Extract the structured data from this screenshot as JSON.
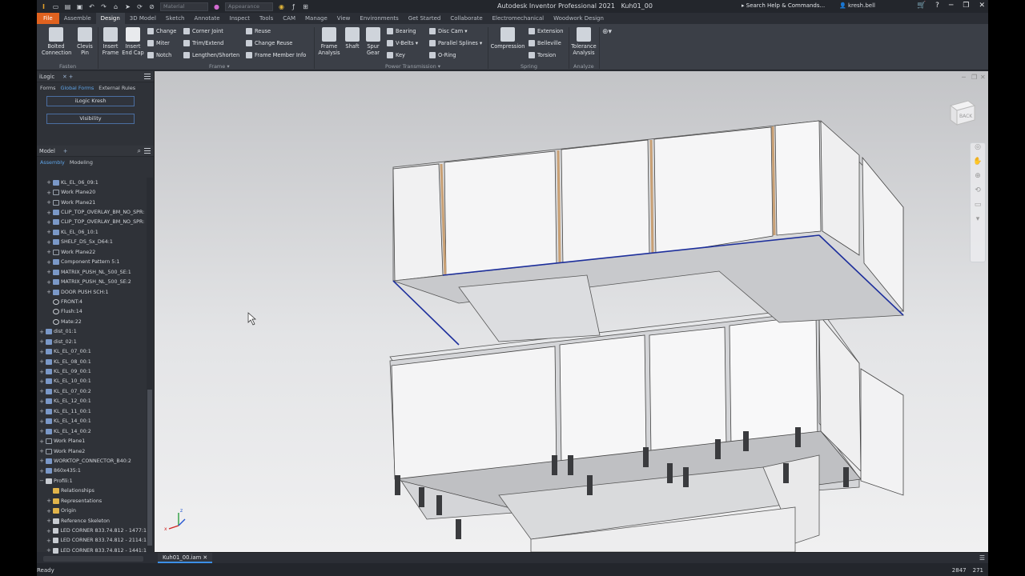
{
  "window": {
    "title": "Autodesk Inventor Professional 2021",
    "document": "Kuh01_00",
    "search_placeholder": "Search Help & Commands...",
    "user": "kresh.bell"
  },
  "qat": {
    "material": "Material",
    "appearance": "Appearance"
  },
  "tabs": [
    "File",
    "Assemble",
    "Design",
    "3D Model",
    "Sketch",
    "Annotate",
    "Inspect",
    "Tools",
    "CAM",
    "Manage",
    "View",
    "Environments",
    "Get Started",
    "Collaborate",
    "Electromechanical",
    "Woodwork Design"
  ],
  "active_tab": "Design",
  "ribbon": {
    "bolted_connection": "Bolted\nConnection",
    "clevis_pin": "Clevis\nPin",
    "fasten_label": "Fasten",
    "insert_frame": "Insert\nFrame",
    "insert_end_cap": "Insert\nEnd Cap",
    "change": "Change",
    "miter": "Miter",
    "notch": "Notch",
    "corner_joint": "Corner Joint",
    "trim_extend": "Trim/Extend",
    "lengthen_shorten": "Lengthen/Shorten",
    "reuse": "Reuse",
    "change_reuse": "Change Reuse",
    "frame_member_info": "Frame Member Info",
    "frame_label": "Frame ▾",
    "frame_analysis": "Frame\nAnalysis",
    "shaft": "Shaft",
    "spur_gear": "Spur\nGear",
    "bearing": "Bearing",
    "v_belts": "V-Belts ▾",
    "key": "Key",
    "disc_cam": "Disc Cam ▾",
    "parallel_splines": "Parallel Splines ▾",
    "o_ring": "O-Ring",
    "power_label": "Power Transmission ▾",
    "compression": "Compression",
    "extension": "Extension",
    "belleville": "Belleville",
    "torsion": "Torsion",
    "spring_label": "Spring",
    "tolerance_analysis": "Tolerance\nAnalysis",
    "analyze_label": "Analyze"
  },
  "logic_panel": {
    "title": "iLogic",
    "subtabs": [
      "Forms",
      "Global Forms",
      "External Rules"
    ],
    "buttons": [
      "iLogic Kresh",
      "Visibility"
    ]
  },
  "model_panel": {
    "title": "Model",
    "subtabs": [
      "Assembly",
      "Modeling"
    ],
    "items": [
      {
        "label": "KL_EL_06_09:1",
        "indent": 1,
        "exp": "+",
        "icon": "part"
      },
      {
        "label": "Work Plane20",
        "indent": 1,
        "exp": "+",
        "icon": "plane"
      },
      {
        "label": "Work Plane21",
        "indent": 1,
        "exp": "+",
        "icon": "plane"
      },
      {
        "label": "CLIP_TOP_OVERLAY_BM_NO_SPR:",
        "indent": 1,
        "exp": "+",
        "icon": "part"
      },
      {
        "label": "CLIP_TOP_OVERLAY_BM_NO_SPR:",
        "indent": 1,
        "exp": "+",
        "icon": "part"
      },
      {
        "label": "KL_EL_06_10:1",
        "indent": 1,
        "exp": "+",
        "icon": "part"
      },
      {
        "label": "SHELF_DS_Sx_D64:1",
        "indent": 1,
        "exp": "+",
        "icon": "part"
      },
      {
        "label": "Work Plane22",
        "indent": 1,
        "exp": "+",
        "icon": "plane"
      },
      {
        "label": "Component Pattern 5:1",
        "indent": 1,
        "exp": "+",
        "icon": "part"
      },
      {
        "label": "MATRIX_PUSH_NL_500_SE:1",
        "indent": 1,
        "exp": "+",
        "icon": "part"
      },
      {
        "label": "MATRIX_PUSH_NL_500_SE:2",
        "indent": 1,
        "exp": "+",
        "icon": "part"
      },
      {
        "label": "DOOR PUSH SCH:1",
        "indent": 1,
        "exp": "+",
        "icon": "part"
      },
      {
        "label": "FRONT:4",
        "indent": 1,
        "exp": "",
        "icon": "con"
      },
      {
        "label": "Flush:14",
        "indent": 1,
        "exp": "",
        "icon": "con"
      },
      {
        "label": "Mate:22",
        "indent": 1,
        "exp": "",
        "icon": "con"
      },
      {
        "label": "dist_01:1",
        "indent": 0,
        "exp": "+",
        "icon": "part"
      },
      {
        "label": "dist_02:1",
        "indent": 0,
        "exp": "+",
        "icon": "part"
      },
      {
        "label": "KL_EL_07_00:1",
        "indent": 0,
        "exp": "+",
        "icon": "part"
      },
      {
        "label": "KL_EL_08_00:1",
        "indent": 0,
        "exp": "+",
        "icon": "part"
      },
      {
        "label": "KL_EL_09_00:1",
        "indent": 0,
        "exp": "+",
        "icon": "part"
      },
      {
        "label": "KL_EL_10_00:1",
        "indent": 0,
        "exp": "+",
        "icon": "part"
      },
      {
        "label": "KL_EL_07_00:2",
        "indent": 0,
        "exp": "+",
        "icon": "part"
      },
      {
        "label": "KL_EL_12_00:1",
        "indent": 0,
        "exp": "+",
        "icon": "part"
      },
      {
        "label": "KL_EL_11_00:1",
        "indent": 0,
        "exp": "+",
        "icon": "part"
      },
      {
        "label": "KL_EL_14_00:1",
        "indent": 0,
        "exp": "+",
        "icon": "part"
      },
      {
        "label": "KL_EL_14_00:2",
        "indent": 0,
        "exp": "+",
        "icon": "part"
      },
      {
        "label": "Work Plane1",
        "indent": 0,
        "exp": "+",
        "icon": "plane"
      },
      {
        "label": "Work Plane2",
        "indent": 0,
        "exp": "+",
        "icon": "plane"
      },
      {
        "label": "WORKTOP_CONNECTOR_B40:2",
        "indent": 0,
        "exp": "+",
        "icon": "part"
      },
      {
        "label": "860x435:1",
        "indent": 0,
        "exp": "+",
        "icon": "part"
      },
      {
        "label": "Profili:1",
        "indent": 0,
        "exp": "−",
        "icon": "frame"
      },
      {
        "label": "Relationships",
        "indent": 1,
        "exp": "",
        "icon": "fold"
      },
      {
        "label": "Representations",
        "indent": 1,
        "exp": "+",
        "icon": "fold"
      },
      {
        "label": "Origin",
        "indent": 1,
        "exp": "+",
        "icon": "fold"
      },
      {
        "label": "Reference Skeleton",
        "indent": 1,
        "exp": "+",
        "icon": "frame"
      },
      {
        "label": "LED CORNER 833.74.812 - 1477:1",
        "indent": 1,
        "exp": "+",
        "icon": "frame"
      },
      {
        "label": "LED CORNER 833.74.812 - 2114:1",
        "indent": 1,
        "exp": "+",
        "icon": "frame"
      },
      {
        "label": "LED CORNER 833.74.812 - 1441:1",
        "indent": 1,
        "exp": "+",
        "icon": "frame"
      }
    ]
  },
  "viewcube_label": "BACK",
  "document_tab": "Kuh01_00.iam",
  "status": {
    "text": "Ready",
    "num1": "2847",
    "num2": "271"
  }
}
